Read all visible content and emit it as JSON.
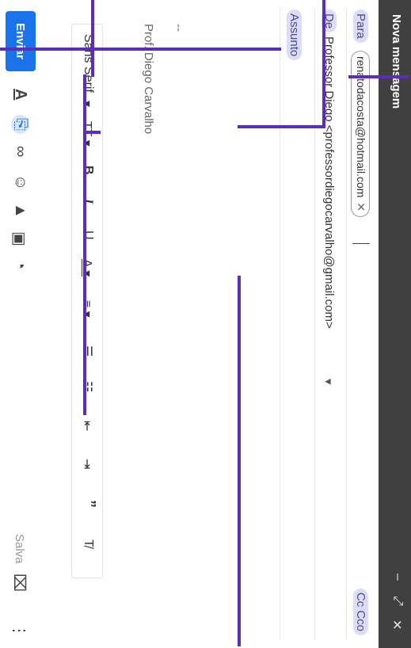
{
  "window": {
    "title": "Nova mensagem",
    "minimize_icon": "–",
    "expand_icon": "⤢",
    "close_icon": "✕"
  },
  "fields": {
    "to_label": "Para",
    "to_chip": "renatodacosta@hotmail.com",
    "chip_remove_icon": "✕",
    "cc_bcc": "Cc Cco",
    "from_label": "De",
    "from_value": "Professor Diego <professordiegocarvalho@gmail.com>",
    "from_dropdown_icon": "▾",
    "subject_placeholder": "Assunto"
  },
  "body": {
    "signature_sep": "--",
    "signature": "Prof. Diego Carvalho"
  },
  "toolbar": {
    "font": "Sans Serif",
    "items": [
      {
        "name": "font-dropdown-icon",
        "glyph": "▾"
      },
      {
        "name": "font-size-icon",
        "glyph": "TT ▾"
      },
      {
        "name": "bold-icon",
        "glyph": "B"
      },
      {
        "name": "italic-icon",
        "glyph": "I"
      },
      {
        "name": "underline-icon",
        "glyph": "U"
      },
      {
        "name": "text-color-icon",
        "glyph": "A ▾"
      },
      {
        "name": "align-icon",
        "glyph": "≡ ▾"
      },
      {
        "name": "numbered-list-icon",
        "glyph": "☰"
      },
      {
        "name": "bulleted-list-icon",
        "glyph": "☷"
      },
      {
        "name": "indent-less-icon",
        "glyph": "⇤"
      },
      {
        "name": "indent-more-icon",
        "glyph": "⇥"
      },
      {
        "name": "quote-icon",
        "glyph": "”"
      },
      {
        "name": "remove-formatting-icon",
        "glyph": "T̸"
      }
    ]
  },
  "bottom": {
    "send": "Enviar",
    "icons": [
      {
        "name": "formatting-options-icon",
        "glyph": "A"
      },
      {
        "name": "attach-icon",
        "glyph": "⎘"
      },
      {
        "name": "link-icon",
        "glyph": "∞"
      },
      {
        "name": "emoji-icon",
        "glyph": "☺"
      },
      {
        "name": "drive-icon",
        "glyph": "▲"
      },
      {
        "name": "photo-icon",
        "glyph": "▣"
      },
      {
        "name": "confidential-icon",
        "glyph": "◔"
      }
    ],
    "saved": "Salva",
    "trash_icon": "⌧",
    "more_icon": "⋮"
  }
}
